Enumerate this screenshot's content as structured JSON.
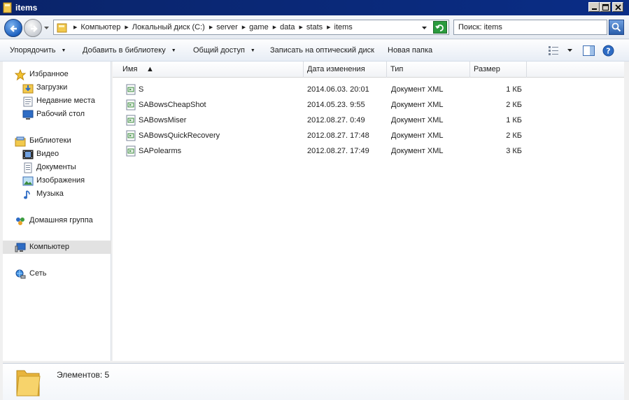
{
  "window": {
    "title": "items"
  },
  "address": {
    "crumbs": [
      "Компьютер",
      "Локальный диск (C:)",
      "server",
      "game",
      "data",
      "stats",
      "items"
    ]
  },
  "search": {
    "value": "Поиск: items"
  },
  "toolbar": {
    "organize": "Упорядочить",
    "add_to_library": "Добавить в библиотеку",
    "share": "Общий доступ",
    "burn": "Записать на оптический диск",
    "new_folder": "Новая папка"
  },
  "sidebar": {
    "favorites": "Избранное",
    "downloads": "Загрузки",
    "recent": "Недавние места",
    "desktop": "Рабочий стол",
    "libraries": "Библиотеки",
    "video": "Видео",
    "documents": "Документы",
    "images": "Изображения",
    "music": "Музыка",
    "homegroup": "Домашняя группа",
    "computer": "Компьютер",
    "network": "Сеть"
  },
  "columns": {
    "name": "Имя",
    "date": "Дата изменения",
    "type": "Тип",
    "size": "Размер"
  },
  "files": [
    {
      "name": "S",
      "date": "2014.06.03. 20:01",
      "type": "Документ XML",
      "size": "1 КБ"
    },
    {
      "name": "SABowsCheapShot",
      "date": "2014.05.23. 9:55",
      "type": "Документ XML",
      "size": "2 КБ"
    },
    {
      "name": "SABowsMiser",
      "date": "2012.08.27. 0:49",
      "type": "Документ XML",
      "size": "1 КБ"
    },
    {
      "name": "SABowsQuickRecovery",
      "date": "2012.08.27. 17:48",
      "type": "Документ XML",
      "size": "2 КБ"
    },
    {
      "name": "SAPolearms",
      "date": "2012.08.27. 17:49",
      "type": "Документ XML",
      "size": "3 КБ"
    }
  ],
  "details": {
    "count": "Элементов: 5"
  },
  "colors": {
    "titlebar": "#0a246a",
    "selection": "#e2e2e2",
    "folder": "#f2c94c"
  }
}
